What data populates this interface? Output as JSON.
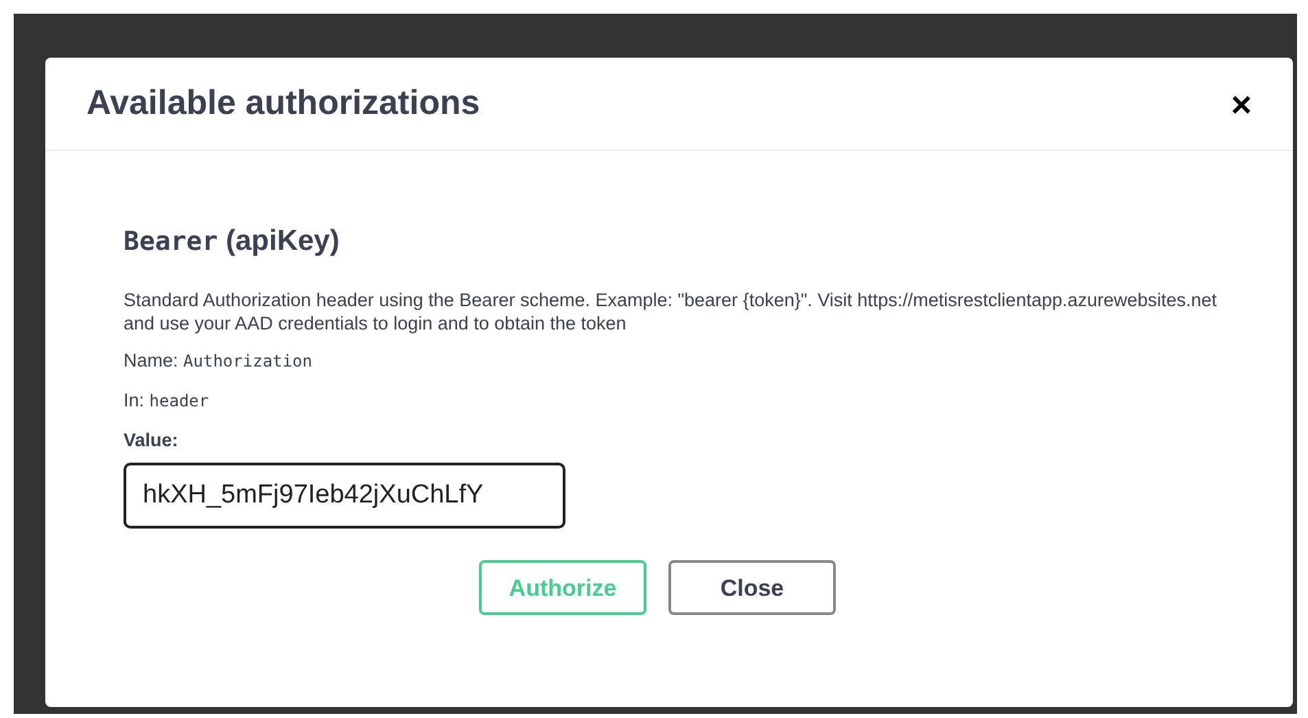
{
  "dialog": {
    "title": "Available authorizations",
    "close_icon": "×"
  },
  "scheme": {
    "title_mono": "Bearer",
    "title_rest": "(apiKey)",
    "description": "Standard Authorization header using the Bearer scheme. Example: \"bearer {token}\". Visit https://metisrestclientapp.azurewebsites.net and use your AAD credentials to login and to obtain the token",
    "name_label": "Name:",
    "name_value": "Authorization",
    "in_label": "In:",
    "in_value": "header",
    "value_label": "Value:",
    "value": "hkXH_5mFj97Ieb42jXuChLfY"
  },
  "buttons": [
    {
      "label": "Authorize",
      "kind": "primary"
    },
    {
      "label": "Close",
      "kind": "secondary"
    }
  ]
}
